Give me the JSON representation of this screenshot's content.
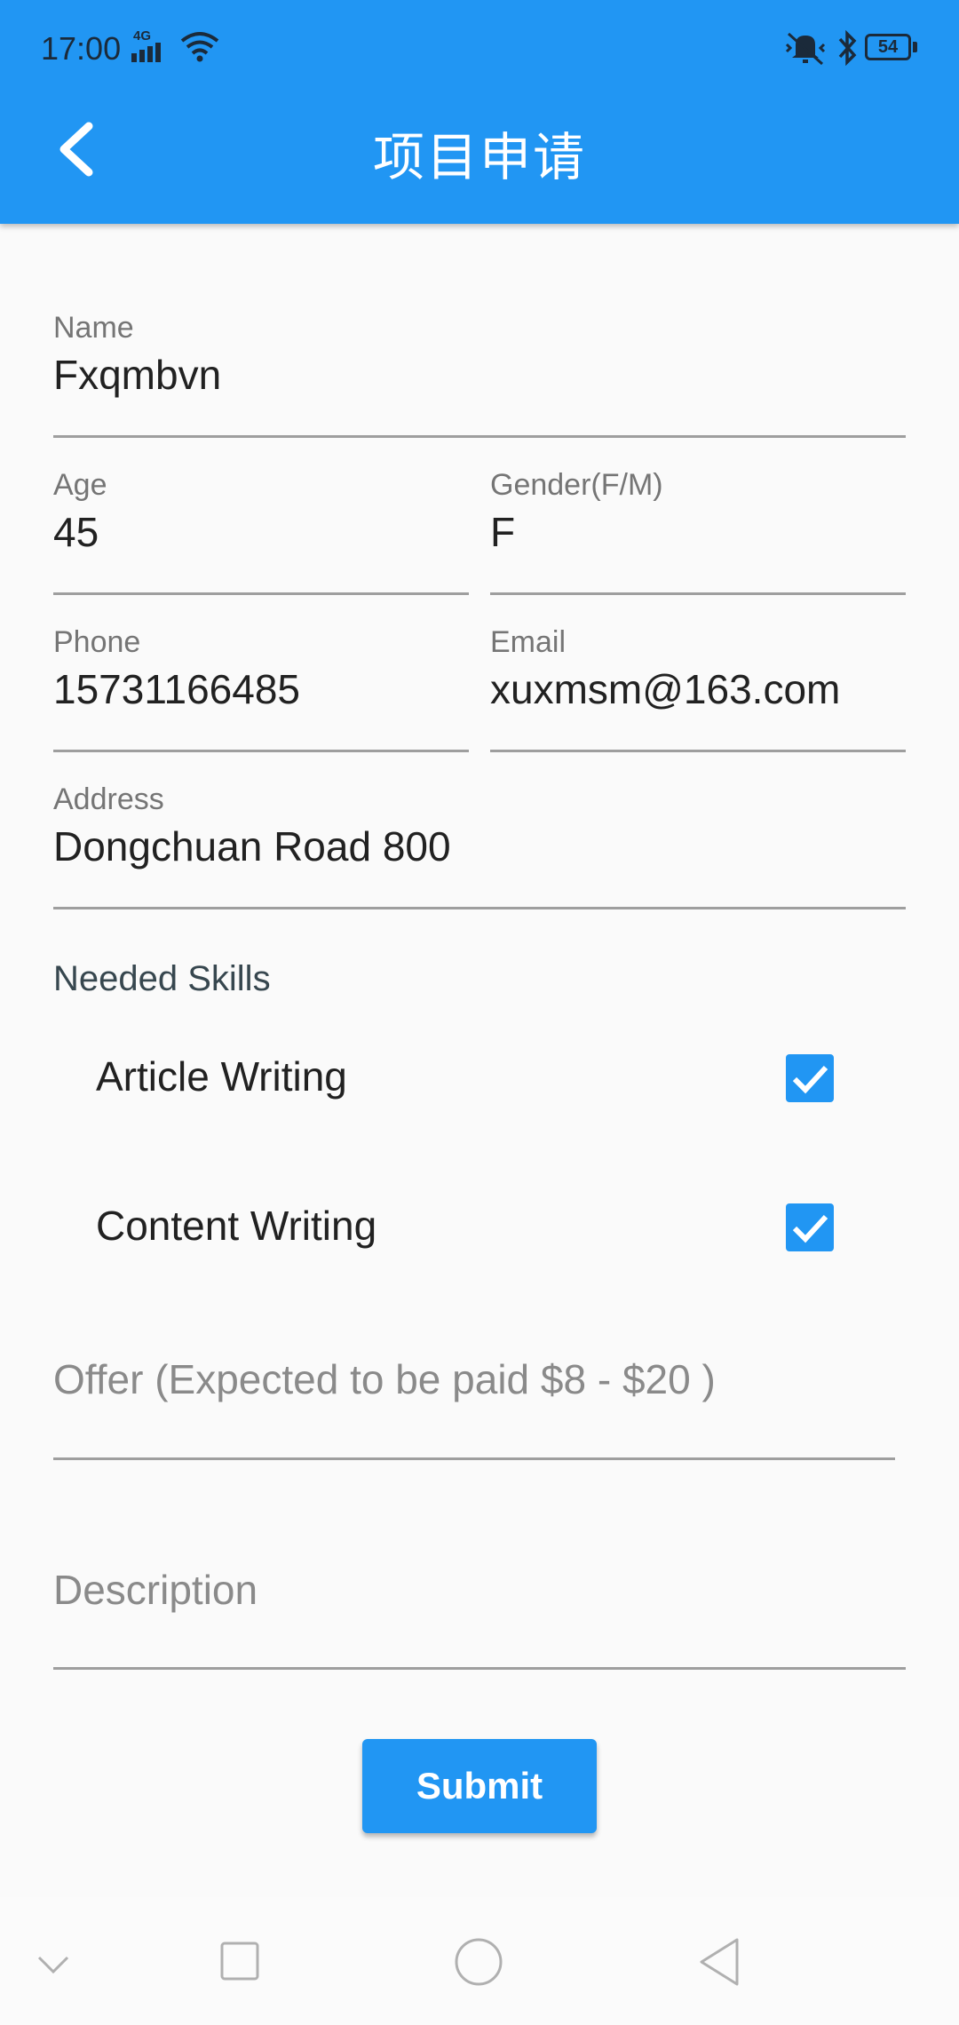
{
  "status_bar": {
    "time": "17:00",
    "network": "4G",
    "battery": "54"
  },
  "app_bar": {
    "title": "项目申请"
  },
  "form": {
    "name": {
      "label": "Name",
      "value": "Fxqmbvn"
    },
    "age": {
      "label": "Age",
      "value": "45"
    },
    "gender": {
      "label": "Gender(F/M)",
      "value": "F"
    },
    "phone": {
      "label": "Phone",
      "value": "15731166485"
    },
    "email": {
      "label": "Email",
      "value": "xuxmsm@163.com"
    },
    "address": {
      "label": "Address",
      "value": "Dongchuan Road 800"
    },
    "skills_title": "Needed Skills",
    "skills": [
      {
        "label": "Article Writing",
        "checked": true
      },
      {
        "label": "Content Writing",
        "checked": true
      }
    ],
    "offer": {
      "placeholder": "Offer (Expected to be paid $8 - $20 )"
    },
    "description": {
      "placeholder": "Description"
    },
    "submit_label": "Submit"
  },
  "colors": {
    "primary": "#2196f3",
    "underline": "#9e9e9e",
    "label": "#757575"
  },
  "icons": [
    "back-arrow-icon",
    "signal-icon",
    "wifi-icon",
    "mute-icon",
    "bluetooth-icon",
    "battery-icon",
    "nav-collapse-icon",
    "nav-recent-icon",
    "nav-home-icon",
    "nav-back-icon"
  ]
}
